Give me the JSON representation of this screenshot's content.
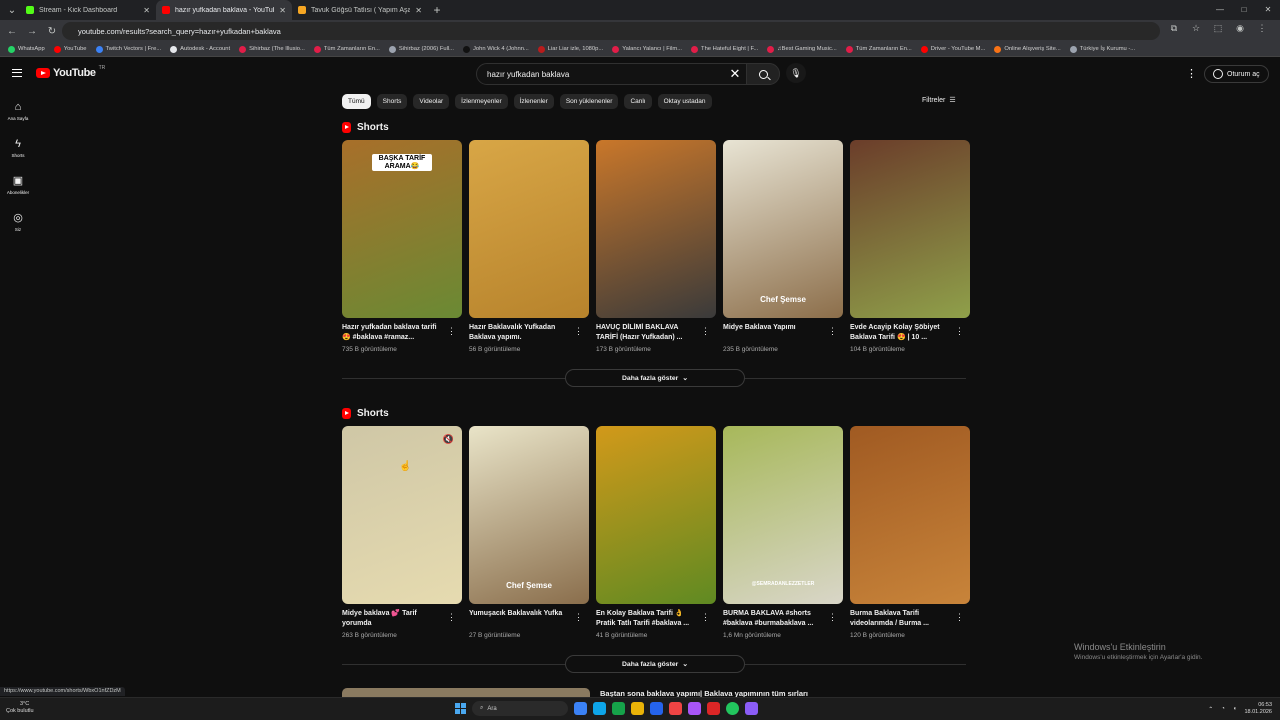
{
  "browser": {
    "tabs": [
      {
        "title": "Stream - Kick Dashboard",
        "icon": "kick-icon",
        "color": "#53fc18",
        "active": false
      },
      {
        "title": "hazır yufkadan baklava - YouTube",
        "icon": "youtube-icon",
        "color": "#ff0000",
        "active": true
      },
      {
        "title": "Tavuk Göğsü Tatlısı ( Yapım Aşa...",
        "icon": "flame-icon",
        "color": "#f5a623",
        "active": false
      }
    ],
    "url": "youtube.com/results?search_query=hazır+yufkadan+baklava",
    "bookmarks": [
      {
        "label": "WhatsApp",
        "color": "#25d366"
      },
      {
        "label": "YouTube",
        "color": "#ff0000"
      },
      {
        "label": "Twitch Vectors | Fre...",
        "color": "#3b82f6"
      },
      {
        "label": "Autodesk - Account",
        "color": "#e5e7eb"
      },
      {
        "label": "Sihirbaz (The Illusio...",
        "color": "#e11d48"
      },
      {
        "label": "Tüm Zamanların En...",
        "color": "#e11d48"
      },
      {
        "label": "Sihirbaz (2006) Full...",
        "color": "#9ca3af"
      },
      {
        "label": "John Wick 4 (Johnn...",
        "color": "#111111"
      },
      {
        "label": "Liar Liar izle, 1080p...",
        "color": "#b91c1c"
      },
      {
        "label": "Yalancı Yalancı | Film...",
        "color": "#e11d48"
      },
      {
        "label": "The Hateful Eight | F...",
        "color": "#e11d48"
      },
      {
        "label": "♫Best Gaming Music...",
        "color": "#e11d48"
      },
      {
        "label": "Tüm Zamanların En...",
        "color": "#e11d48"
      },
      {
        "label": "Driver - YouTube M...",
        "color": "#ff0000"
      },
      {
        "label": "Online Alışveriş Site...",
        "color": "#f97316"
      },
      {
        "label": "Türkiye İş Kurumu -...",
        "color": "#9ca3af"
      }
    ],
    "status_url": "https://www.youtube.com/shorts/WbxO1nfZDzM"
  },
  "youtube": {
    "logo_text": "YouTube",
    "country": "TR",
    "search_value": "hazır yufkadan baklava",
    "sign_in": "Oturum aç",
    "nav": [
      {
        "label": "Ana Sayfa",
        "icon": "home-icon"
      },
      {
        "label": "Shorts",
        "icon": "shorts-icon"
      },
      {
        "label": "Abonelikler",
        "icon": "subscriptions-icon"
      },
      {
        "label": "Siz",
        "icon": "you-icon"
      }
    ],
    "chips": [
      "Tümü",
      "Shorts",
      "Videolar",
      "İzlenmeyenler",
      "İzlenenler",
      "Son yüklenenler",
      "Canlı",
      "Oktay ustadan"
    ],
    "filters_label": "Filtreler",
    "show_more": "Daha fazla göster",
    "shelves": [
      {
        "title": "Shorts",
        "items": [
          {
            "title": "Hazır yufkadan baklava tarifi😍 #baklava #ramaz...",
            "views": "735 B görüntüleme",
            "overlay": "BAŞKA TARİF ARAMA😂",
            "c1": "#a86f2a",
            "c2": "#6a8a34"
          },
          {
            "title": "Hazır Baklavalık Yufkadan Baklava yapımı.",
            "views": "56 B görüntüleme",
            "overlay": "",
            "c1": "#d8a646",
            "c2": "#b7832c"
          },
          {
            "title": "HAVUÇ DİLİMİ BAKLAVA TARİFİ (Hazır Yufkadan) ...",
            "views": "173 B görüntüleme",
            "overlay": "",
            "c1": "#c9772a",
            "c2": "#3a3a3a"
          },
          {
            "title": "Midye Baklava Yapımı",
            "views": "235 B görüntüleme",
            "overlay": "Chef Şemse",
            "c1": "#e8e4d4",
            "c2": "#8c6e4a"
          },
          {
            "title": "Evde Acayip Kolay Şöbiyet Baklava Tarifi 😍 | 10 ...",
            "views": "104 B görüntüleme",
            "overlay": "",
            "c1": "#6b3d2a",
            "c2": "#8fa04a"
          }
        ]
      },
      {
        "title": "Shorts",
        "items": [
          {
            "title": "Midye baklava 💕 Tarif yorumda",
            "views": "263 B görüntüleme",
            "overlay": "",
            "c1": "#cfc7a6",
            "c2": "#e6dbb0"
          },
          {
            "title": "Yumuşacık Baklavalık Yufka",
            "views": "27 B görüntüleme",
            "overlay": "Chef Şemse",
            "c1": "#e9e4c8",
            "c2": "#8a6e4c"
          },
          {
            "title": "En Kolay Baklava Tarifi 👌 Pratik Tatlı Tarifi #baklava ...",
            "views": "41 B görüntüleme",
            "overlay": "",
            "c1": "#d2991a",
            "c2": "#5f8a22"
          },
          {
            "title": "BURMA BAKLAVA #shorts #baklava #burmabaklava ...",
            "views": "1,6 Mn görüntüleme",
            "overlay": "@SEMRADANLEZZETLER",
            "c1": "#a7b85a",
            "c2": "#d9d6c8"
          },
          {
            "title": "Burma Baklava Tarifi videolarımda / Burma ...",
            "views": "120 B görüntüleme",
            "overlay": "",
            "c1": "#a05a22",
            "c2": "#c8843a"
          }
        ]
      }
    ],
    "next_title": "Baştan sona baklava yapımı| Baklava yapımının tüm sırları"
  },
  "watermark": {
    "line1": "Windows'u Etkinleştirin",
    "line2": "Windows'u etkinleştirmek için Ayarlar'a gidin."
  },
  "taskbar": {
    "temp": "3°C",
    "weather": "Çok bulutlu",
    "search": "Ara",
    "time": "06:53",
    "date": "18.01.2026"
  }
}
